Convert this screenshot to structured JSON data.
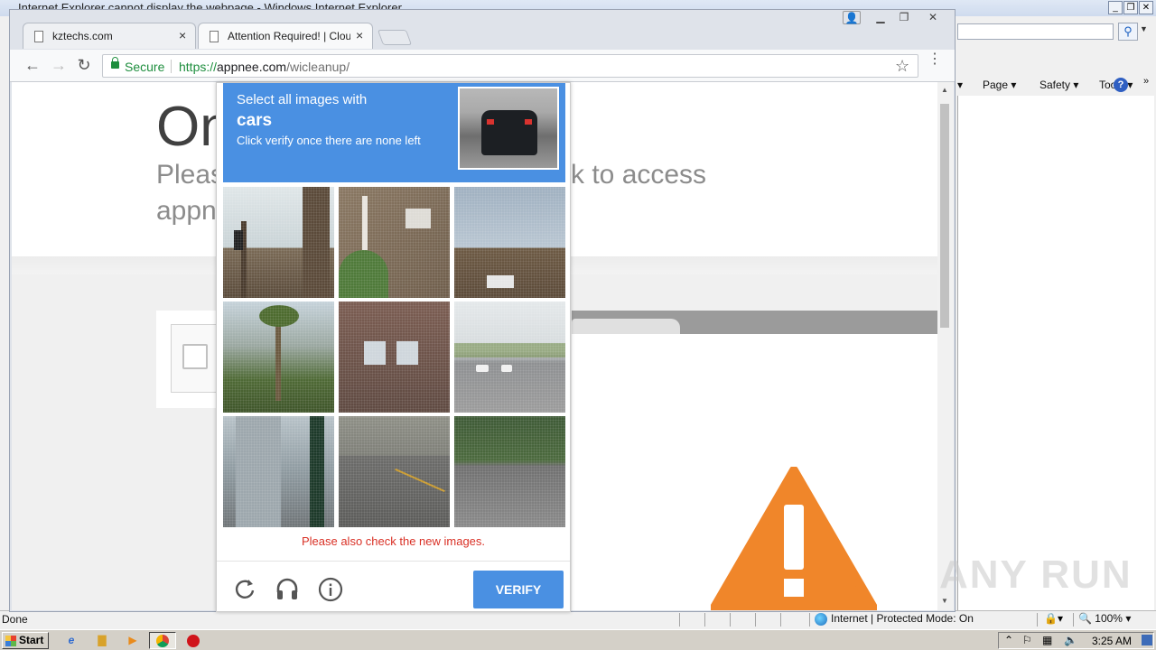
{
  "ie": {
    "title": "Internet Explorer cannot display the webpage - Windows Internet Explorer",
    "command_bar": [
      "Page",
      "Safety",
      "Tools"
    ],
    "help_label": "?",
    "status_left": "Done",
    "zone_text": "Internet | Protected Mode: On",
    "zoom": "100%"
  },
  "chrome": {
    "tabs": [
      {
        "title": "kztechs.com",
        "close": "×"
      },
      {
        "title": "Attention Required! | Cloudflare",
        "close": "×"
      }
    ],
    "omnibox": {
      "secure_label": "Secure",
      "scheme": "https://",
      "host": "appnee.com",
      "path": "/wicleanup/"
    }
  },
  "page": {
    "heading": "On",
    "subtitle_part1": "Pleas",
    "subtitle_part2": "k to access",
    "subtitle_part3": "appn"
  },
  "recaptcha": {
    "instruction_line1": "Select all images with",
    "target": "cars",
    "instruction_line3": "Click verify once there are none left",
    "error": "Please also check the new images.",
    "verify_label": "VERIFY",
    "controls": [
      "reload-icon",
      "audio-icon",
      "info-icon"
    ]
  },
  "watermark": "ANY RUN",
  "taskbar": {
    "start_label": "Start",
    "clock": "3:25 AM"
  }
}
